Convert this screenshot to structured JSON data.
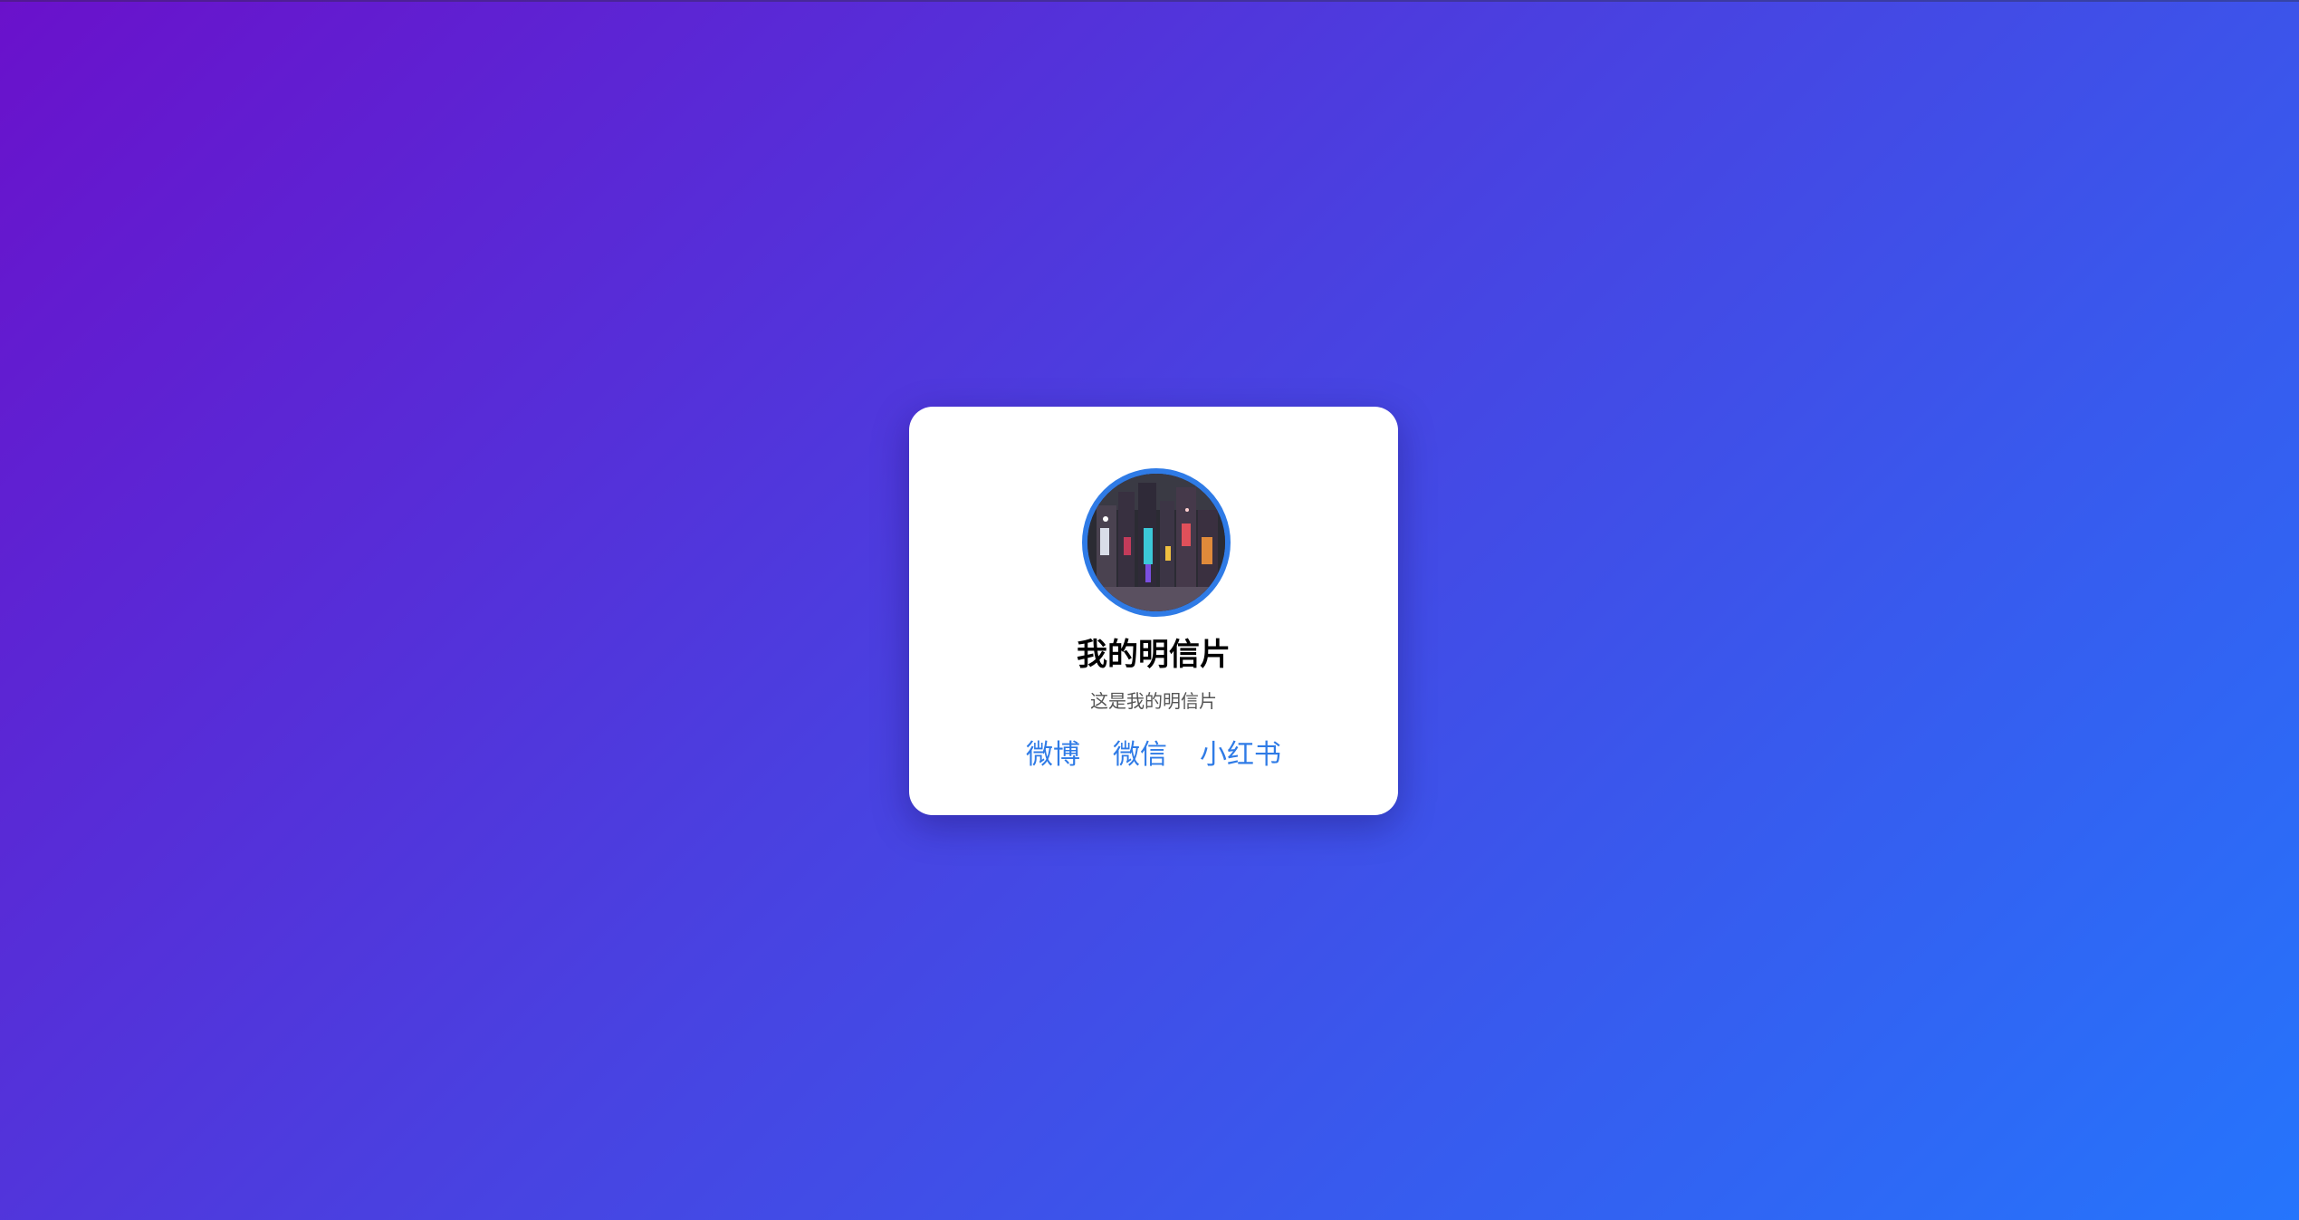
{
  "colors": {
    "background_gradient_start": "#6a11cb",
    "background_gradient_end": "#2575fc",
    "card_background": "#ffffff",
    "accent": "#2f7be6",
    "title": "#000000",
    "subtitle": "#555555"
  },
  "card": {
    "avatar": {
      "icon": "avatar-photo-icon",
      "description_shown": false
    },
    "title": "我的明信片",
    "subtitle": "这是我的明信片",
    "links": [
      {
        "label": "微博"
      },
      {
        "label": "微信"
      },
      {
        "label": "小红书"
      }
    ]
  }
}
